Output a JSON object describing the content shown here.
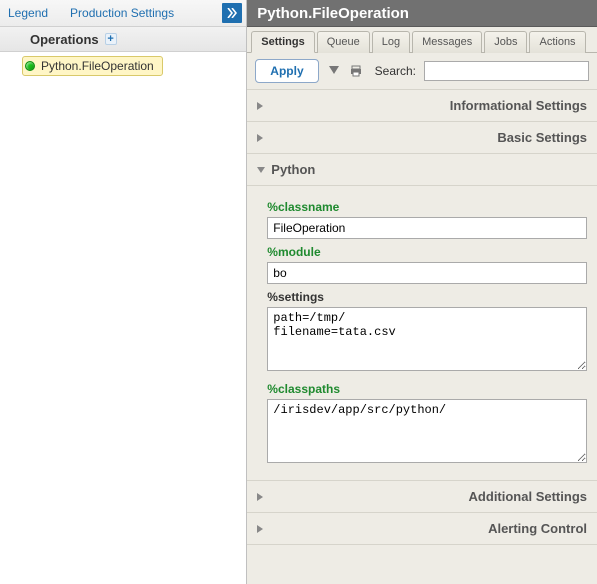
{
  "left": {
    "links": {
      "legend": "Legend",
      "prodSettings": "Production Settings"
    },
    "ops_header": "Operations",
    "item": {
      "label": "Python.FileOperation",
      "status": "running"
    }
  },
  "right": {
    "title": "Python.FileOperation",
    "tabs": [
      "Settings",
      "Queue",
      "Log",
      "Messages",
      "Jobs",
      "Actions"
    ],
    "activeTab": 0,
    "apply": "Apply",
    "search_label": "Search:",
    "search_value": "",
    "sections": {
      "info": "Informational Settings",
      "basic": "Basic Settings",
      "python": "Python",
      "additional": "Additional Settings",
      "alerting": "Alerting Control"
    },
    "python": {
      "classname_label": "%classname",
      "classname_value": "FileOperation",
      "module_label": "%module",
      "module_value": "bo",
      "settings_label": "%settings",
      "settings_value": "path=/tmp/\nfilename=tata.csv",
      "classpaths_label": "%classpaths",
      "classpaths_value": "/irisdev/app/src/python/"
    }
  }
}
